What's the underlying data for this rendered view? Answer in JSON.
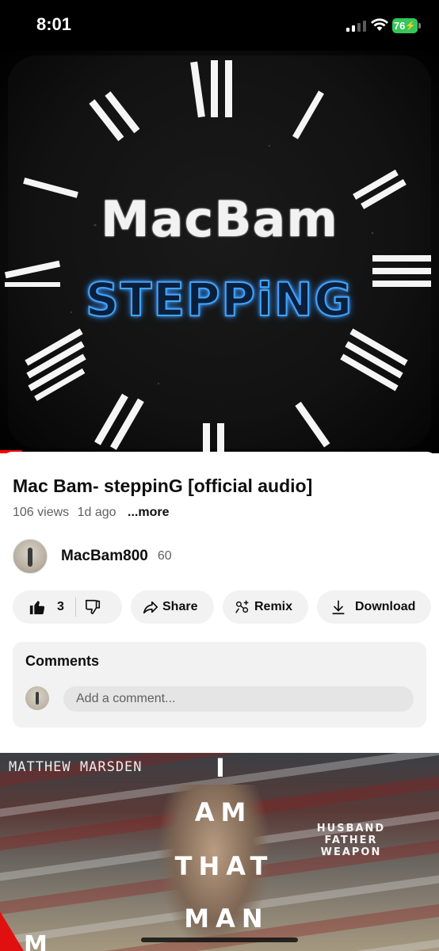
{
  "status_bar": {
    "time": "8:01",
    "battery": "76"
  },
  "player": {
    "art_title": "MacBam",
    "art_subtitle": "STEPPiNG",
    "progress_fraction": 0.05
  },
  "video": {
    "title": "Mac Bam- steppinG [official audio]",
    "views": "106 views",
    "age": "1d ago",
    "more": "...more"
  },
  "channel": {
    "name": "MacBam800",
    "subscribers": "60"
  },
  "actions": {
    "like_count": "3",
    "share": "Share",
    "remix": "Remix",
    "download": "Download"
  },
  "comments": {
    "header": "Comments",
    "placeholder": "Add a comment..."
  },
  "next_video": {
    "author": "MATTHEW MARSDEN",
    "title_lines": [
      "I",
      "AM",
      "THAT",
      "MAN"
    ],
    "tagline": "HUSBAND FATHER WEAPON",
    "corner_letter": "M"
  },
  "colors": {
    "accent": "#ff0000",
    "battery": "#34c759",
    "pill_bg": "#f2f2f2"
  }
}
